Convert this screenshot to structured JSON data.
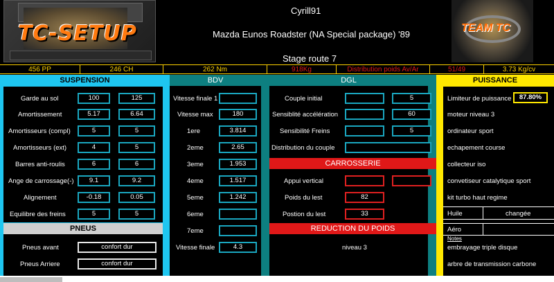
{
  "header": {
    "logo_left_text": "TC-SETUP",
    "user": "Cyrill91",
    "car": "Mazda Eunos Roadster (NA Special package) '89",
    "stage": "Stage route 7",
    "logo_right_text": "TEAM TC"
  },
  "stats": [
    "456 PP",
    "246 CH",
    "262 Nm",
    "918Kg",
    "Distribution poids Av/Ar",
    "51/49",
    "3.73 Kg/cv"
  ],
  "suspension": {
    "title": "SUSPENSION",
    "rows": [
      {
        "label": "Garde au sol",
        "a": "100",
        "b": "125"
      },
      {
        "label": "Amortissement",
        "a": "5.17",
        "b": "6.64"
      },
      {
        "label": "Amortisseurs (compl)",
        "a": "5",
        "b": "5"
      },
      {
        "label": "Amortisseurs (ext)",
        "a": "4",
        "b": "5"
      },
      {
        "label": "Barres anti-roulis",
        "a": "6",
        "b": "6"
      },
      {
        "label": "Ange de carrossage(-)",
        "a": "9.1",
        "b": "9.2"
      },
      {
        "label": "Alignement",
        "a": "-0.18",
        "b": "0.05"
      },
      {
        "label": "Equilibre des freins",
        "a": "5",
        "b": "5"
      }
    ]
  },
  "pneus": {
    "title": "PNEUS",
    "rows": [
      {
        "label": "Pneus avant",
        "value": "confort dur"
      },
      {
        "label": "Pneus Arriere",
        "value": "confort dur"
      }
    ]
  },
  "bdv": {
    "title": "BDV",
    "rows": [
      {
        "label": "Vitesse finale 1",
        "value": ""
      },
      {
        "label": "Vitesse max",
        "value": "180"
      },
      {
        "label": "1ere",
        "value": "3.814"
      },
      {
        "label": "2eme",
        "value": "2.65"
      },
      {
        "label": "3eme",
        "value": "1.953"
      },
      {
        "label": "4eme",
        "value": "1.517"
      },
      {
        "label": "5eme",
        "value": "1.242"
      },
      {
        "label": "6eme",
        "value": ""
      },
      {
        "label": "7eme",
        "value": ""
      },
      {
        "label": "Vitesse finale",
        "value": "4.3"
      }
    ]
  },
  "dgl": {
    "title": "DGL",
    "rows": [
      {
        "label": "Couple initial",
        "a": "",
        "b": "5"
      },
      {
        "label": "Sensiblité accélération",
        "a": "",
        "b": "60"
      },
      {
        "label": "Sensibilité Freins",
        "a": "",
        "b": "5"
      },
      {
        "label": "Distribution du couple",
        "wide": ""
      }
    ]
  },
  "carrosserie": {
    "title": "CARROSSERIE",
    "rows": [
      {
        "label": "Appui vertical",
        "a": "",
        "b": ""
      },
      {
        "label": "Poids du lest",
        "a": "82"
      },
      {
        "label": "Postion du lest",
        "a": "33"
      }
    ]
  },
  "reduction": {
    "title": "REDUCTION DU POIDS",
    "value": "niveau 3"
  },
  "puissance": {
    "title": "PUISSANCE",
    "limiter_label": "Limiteur de puissance",
    "limiter_value": "87.80%",
    "items": [
      "moteur niveau 3",
      "ordinateur sport",
      "echapement course",
      "collecteur iso",
      "convetiseur catalytique sport",
      "kit turbo haut regime"
    ],
    "huile_label": "Huile",
    "huile_value": "changée",
    "aero_label": "Aéro",
    "notes_label": "Notes",
    "notes": [
      "embrayage triple disque",
      "arbre de transmission carbone"
    ]
  },
  "colors": {
    "cyan": "#1ec6f0",
    "teal": "#0d7f80",
    "red": "#e01818",
    "yellow": "#ffe800",
    "grey": "#cfcfcf"
  }
}
